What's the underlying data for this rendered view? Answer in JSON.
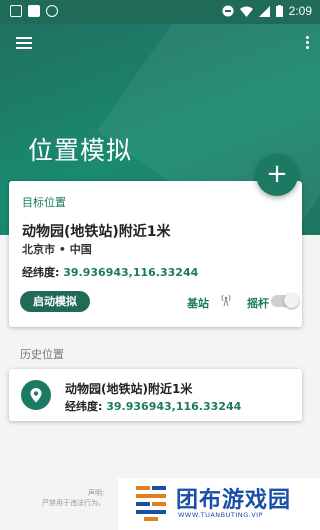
{
  "status_bar": {
    "time": "2:09"
  },
  "header": {
    "title": "位置模拟"
  },
  "main_card": {
    "target_label": "目标位置",
    "place_name": "动物园(地铁站)附近1米",
    "city": "北京市 • 中国",
    "coord_label": "经纬度:",
    "coord_value": "39.936943,116.33244",
    "start_button": "启动模拟",
    "station_label": "基站",
    "joystick_label": "摇杆",
    "joystick_enabled": false
  },
  "history": {
    "label": "历史位置",
    "items": [
      {
        "place_name": "动物园(地铁站)附近1米",
        "coord_label": "经纬度:",
        "coord_value": "39.936943,116.33244"
      }
    ]
  },
  "footer": {
    "line1": "声明:",
    "line2": "严禁用于违法行为。"
  },
  "watermark": {
    "title": "团布游戏园",
    "subtitle": "WWW.TUANBUTING.VIP"
  },
  "colors": {
    "primary": "#1f6b58",
    "accent": "#1b7a62",
    "background": "#f4f4f4"
  }
}
